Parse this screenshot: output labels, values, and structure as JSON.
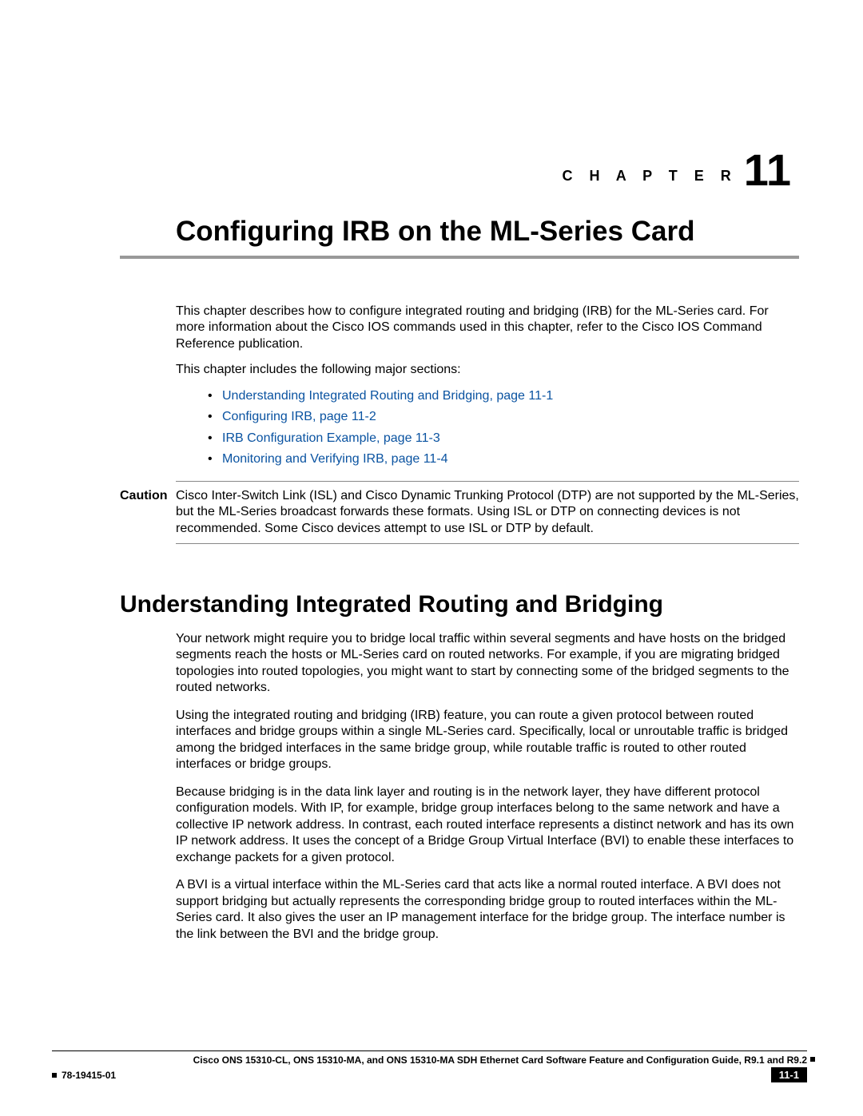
{
  "chapter": {
    "label": "C H A P T E R",
    "number": "11"
  },
  "title": "Configuring IRB on the ML-Series Card",
  "intro": {
    "p1": "This chapter describes how to configure integrated routing and bridging (IRB) for the ML-Series card. For more information about the Cisco IOS commands used in this chapter, refer to the Cisco IOS Command Reference publication.",
    "p2": "This chapter includes the following major sections:"
  },
  "toc": [
    "Understanding Integrated Routing and Bridging, page 11-1",
    "Configuring IRB, page 11-2",
    "IRB Configuration Example, page 11-3",
    "Monitoring and Verifying IRB, page 11-4"
  ],
  "caution": {
    "label": "Caution",
    "text": "Cisco Inter-Switch Link (ISL) and Cisco Dynamic Trunking Protocol (DTP) are not supported by the ML-Series, but the ML-Series broadcast forwards these formats. Using ISL or DTP on connecting devices is not recommended. Some Cisco devices attempt to use ISL or DTP by default."
  },
  "section": {
    "heading": "Understanding Integrated Routing and Bridging",
    "p1": "Your network might require you to bridge local traffic within several segments and have hosts on the bridged segments reach the hosts or ML-Series card on routed networks. For example, if you are migrating bridged topologies into routed topologies, you might want to start by connecting some of the bridged segments to the routed networks.",
    "p2": "Using the integrated routing and bridging (IRB) feature, you can route a given protocol between routed interfaces and bridge groups within a single ML-Series card. Specifically, local or unroutable traffic is bridged among the bridged interfaces in the same bridge group, while routable traffic is routed to other routed interfaces or bridge groups.",
    "p3": "Because bridging is in the data link layer and routing is in the network layer, they have different protocol configuration models. With IP, for example, bridge group interfaces belong to the same network and have a collective IP network address. In contrast, each routed interface represents a distinct network and has its own IP network address. It uses the concept of a Bridge Group Virtual Interface (BVI) to enable these interfaces to exchange packets for a given protocol.",
    "p4": "A BVI is a virtual interface within the ML-Series card that acts like a normal routed interface. A BVI does not support bridging but actually represents the corresponding bridge group to routed interfaces within the ML-Series card. It also gives the user an IP management interface for the bridge group. The interface number is the link between the BVI and the bridge group."
  },
  "footer": {
    "book_title": "Cisco ONS 15310-CL, ONS 15310-MA, and ONS 15310-MA SDH Ethernet Card Software Feature and Configuration Guide, R9.1 and R9.2",
    "doc_number": "78-19415-01",
    "page_number": "11-1"
  }
}
